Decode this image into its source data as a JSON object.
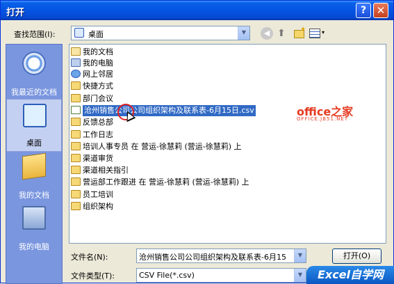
{
  "window": {
    "title": "打开"
  },
  "titlebar": {
    "help_label": "?",
    "close_label": "✕"
  },
  "look_in": {
    "label": "查找范围(I):",
    "value": "桌面",
    "drop_glyph": "▼"
  },
  "toolbar": {
    "back_glyph": "◀",
    "up_glyph": "⬆",
    "newfolder_glyph": "✦",
    "views_glyph": "▾"
  },
  "places": [
    {
      "label": "我最近的文档",
      "icon": "recent-docs-icon"
    },
    {
      "label": "桌面",
      "icon": "desktop-icon"
    },
    {
      "label": "我的文档",
      "icon": "my-documents-icon"
    },
    {
      "label": "我的电脑",
      "icon": "my-computer-icon"
    }
  ],
  "files": [
    {
      "name": "我的文档",
      "icon": "docs-folder"
    },
    {
      "name": "我的电脑",
      "icon": "computer"
    },
    {
      "name": "网上邻居",
      "icon": "network"
    },
    {
      "name": "快捷方式",
      "icon": "folder"
    },
    {
      "name": "部门会议",
      "icon": "folder"
    },
    {
      "name": "沧州销售公司公司组织架构及联系表-6月15日.csv",
      "icon": "csv-file",
      "selected": true
    },
    {
      "name": "反馈总部",
      "icon": "folder"
    },
    {
      "name": "工作日志",
      "icon": "folder"
    },
    {
      "name": "培训人事专员 在 营运-徐慧莉 (营运-徐慧莉) 上",
      "icon": "shared-folder"
    },
    {
      "name": "渠道审货",
      "icon": "folder"
    },
    {
      "name": "渠道相关指引",
      "icon": "folder"
    },
    {
      "name": "营运部工作跟进 在 营运-徐慧莉 (营运-徐慧莉) 上",
      "icon": "shared-folder"
    },
    {
      "name": "员工培训",
      "icon": "folder"
    },
    {
      "name": "组织架构",
      "icon": "folder"
    }
  ],
  "filename": {
    "label": "文件名(N):",
    "value": "沧州销售公司公司组织架构及联系表-6月15"
  },
  "filetype": {
    "label": "文件类型(T):",
    "value": "CSV File(*.csv)"
  },
  "open_button": {
    "label": "打开(O)"
  },
  "watermarks": {
    "office": "office之家",
    "office_sub": "OFFICE.JB51.NET",
    "excel": "Excel自学网"
  }
}
